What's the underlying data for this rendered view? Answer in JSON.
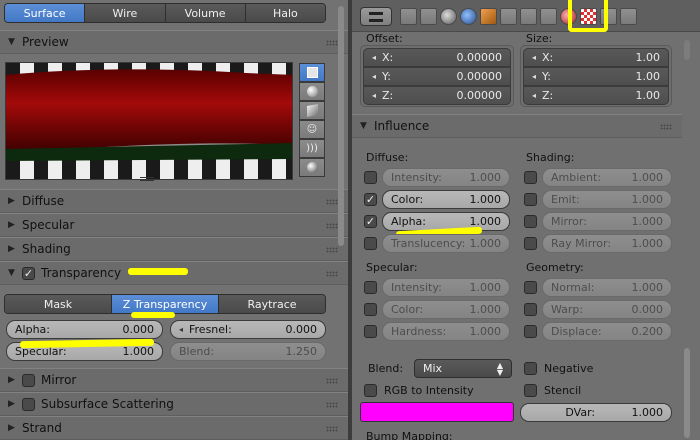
{
  "left": {
    "material_tabs": [
      {
        "label": "Surface",
        "active": true
      },
      {
        "label": "Wire",
        "active": false
      },
      {
        "label": "Volume",
        "active": false
      },
      {
        "label": "Halo",
        "active": false
      }
    ],
    "preview": {
      "label": "Preview"
    },
    "panels": {
      "diffuse": "Diffuse",
      "specular": "Specular",
      "shading": "Shading",
      "transparency": "Transparency",
      "mirror": "Mirror",
      "sss": "Subsurface Scattering",
      "strand": "Strand"
    },
    "transparency_modes": [
      {
        "label": "Mask",
        "active": false
      },
      {
        "label": "Z Transparency",
        "active": true
      },
      {
        "label": "Raytrace",
        "active": false
      }
    ],
    "alpha": {
      "label": "Alpha:",
      "value": "0.000"
    },
    "fresnel": {
      "label": "Fresnel:",
      "value": "0.000"
    },
    "specular_field": {
      "label": "Specular:",
      "value": "1.000"
    },
    "blend": {
      "label": "Blend:",
      "value": "1.250"
    }
  },
  "right": {
    "offset": {
      "label": "Offset:",
      "x_label": "X:",
      "y_label": "Y:",
      "z_label": "Z:",
      "x": "0.00000",
      "y": "0.00000",
      "z": "0.00000"
    },
    "size": {
      "label": "Size:",
      "x_label": "X:",
      "y_label": "Y:",
      "z_label": "Z:",
      "x": "1.00",
      "y": "1.00",
      "z": "1.00"
    },
    "influence": {
      "label": "Influence",
      "diffuse_label": "Diffuse:",
      "shading_label": "Shading:",
      "specular_label": "Specular:",
      "geometry_label": "Geometry:",
      "diffuse": [
        {
          "label": "Intensity:",
          "value": "1.000",
          "checked": false
        },
        {
          "label": "Color:",
          "value": "1.000",
          "checked": true
        },
        {
          "label": "Alpha:",
          "value": "1.000",
          "checked": true
        },
        {
          "label": "Translucency:",
          "value": "1.000",
          "checked": false
        }
      ],
      "shading": [
        {
          "label": "Ambient:",
          "value": "1.000"
        },
        {
          "label": "Emit:",
          "value": "1.000"
        },
        {
          "label": "Mirror:",
          "value": "1.000"
        },
        {
          "label": "Ray Mirror:",
          "value": "1.000"
        }
      ],
      "specular": [
        {
          "label": "Intensity:",
          "value": "1.000"
        },
        {
          "label": "Color:",
          "value": "1.000"
        },
        {
          "label": "Hardness:",
          "value": "1.000"
        }
      ],
      "geometry": [
        {
          "label": "Normal:",
          "value": "1.000"
        },
        {
          "label": "Warp:",
          "value": "0.000"
        },
        {
          "label": "Displace:",
          "value": "0.200"
        }
      ]
    },
    "blend_label": "Blend:",
    "blend_value": "Mix",
    "negative_label": "Negative",
    "rgb_to_intensity_label": "RGB to Intensity",
    "stencil_label": "Stencil",
    "dvar": {
      "label": "DVar:",
      "value": "1.000"
    },
    "bump_mapping_label": "Bump Mapping:",
    "swatch_color": "#ff00ff"
  },
  "colors": {
    "highlight": "#ffff00",
    "active_tab": "#4a82d0"
  }
}
